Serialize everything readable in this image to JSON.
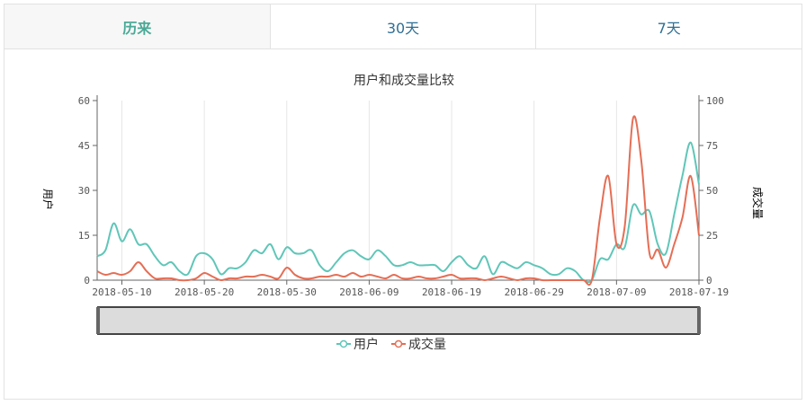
{
  "tabs": [
    {
      "label": "历来",
      "active": true
    },
    {
      "label": "30天",
      "active": false
    },
    {
      "label": "7天",
      "active": false
    }
  ],
  "colors": {
    "users": "#5fc6b8",
    "orders": "#e56e55",
    "active_tab_text": "#4aa996",
    "tab_text": "#2e6f93"
  },
  "chart_data": {
    "type": "line",
    "title": "用户和成交量比较",
    "y_left_label": "用户",
    "y_right_label": "成交量",
    "y_left_ticks": [
      "0",
      "15",
      "30",
      "45",
      "60"
    ],
    "y_right_ticks": [
      "0",
      "25",
      "50",
      "75",
      "100"
    ],
    "y_left_range": [
      0,
      60
    ],
    "y_right_range": [
      0,
      100
    ],
    "x_tick_labels": [
      "2018-05-10",
      "2018-05-20",
      "2018-05-30",
      "2018-06-09",
      "2018-06-19",
      "2018-06-29",
      "2018-07-09",
      "2018-07-19"
    ],
    "x_range": [
      "2018-05-07",
      "2018-07-19"
    ],
    "grid": "vertical",
    "legend": "bottom-center",
    "series": [
      {
        "name": "用户",
        "axis": "left",
        "x": [
          "2018-05-07",
          "2018-05-08",
          "2018-05-09",
          "2018-05-10",
          "2018-05-11",
          "2018-05-12",
          "2018-05-13",
          "2018-05-14",
          "2018-05-15",
          "2018-05-16",
          "2018-05-17",
          "2018-05-18",
          "2018-05-19",
          "2018-05-20",
          "2018-05-21",
          "2018-05-22",
          "2018-05-23",
          "2018-05-24",
          "2018-05-25",
          "2018-05-26",
          "2018-05-27",
          "2018-05-28",
          "2018-05-29",
          "2018-05-30",
          "2018-05-31",
          "2018-06-01",
          "2018-06-02",
          "2018-06-03",
          "2018-06-04",
          "2018-06-05",
          "2018-06-06",
          "2018-06-07",
          "2018-06-08",
          "2018-06-09",
          "2018-06-10",
          "2018-06-11",
          "2018-06-12",
          "2018-06-13",
          "2018-06-14",
          "2018-06-15",
          "2018-06-16",
          "2018-06-17",
          "2018-06-18",
          "2018-06-19",
          "2018-06-20",
          "2018-06-21",
          "2018-06-22",
          "2018-06-23",
          "2018-06-24",
          "2018-06-25",
          "2018-06-26",
          "2018-06-27",
          "2018-06-28",
          "2018-06-29",
          "2018-06-30",
          "2018-07-01",
          "2018-07-02",
          "2018-07-03",
          "2018-07-04",
          "2018-07-05",
          "2018-07-06",
          "2018-07-07",
          "2018-07-08",
          "2018-07-09",
          "2018-07-10",
          "2018-07-11",
          "2018-07-12",
          "2018-07-13",
          "2018-07-14",
          "2018-07-15",
          "2018-07-16",
          "2018-07-17",
          "2018-07-18",
          "2018-07-19"
        ],
        "values": [
          8,
          10,
          19,
          13,
          17,
          12,
          12,
          8,
          5,
          6,
          3,
          2,
          8,
          9,
          7,
          2,
          4,
          4,
          6,
          10,
          9,
          12,
          7,
          11,
          9,
          9,
          10,
          5,
          3,
          6,
          9,
          10,
          8,
          7,
          10,
          8,
          5,
          5,
          6,
          5,
          5,
          5,
          3,
          6,
          8,
          5,
          4,
          8,
          2,
          6,
          5,
          4,
          6,
          5,
          4,
          2,
          2,
          4,
          3,
          0,
          0,
          7,
          7,
          12,
          11,
          25,
          22,
          23,
          12,
          9,
          22,
          35,
          46,
          32
        ]
      },
      {
        "name": "成交量",
        "axis": "right",
        "x": [
          "2018-05-07",
          "2018-05-08",
          "2018-05-09",
          "2018-05-10",
          "2018-05-11",
          "2018-05-12",
          "2018-05-13",
          "2018-05-14",
          "2018-05-15",
          "2018-05-16",
          "2018-05-17",
          "2018-05-18",
          "2018-05-19",
          "2018-05-20",
          "2018-05-21",
          "2018-05-22",
          "2018-05-23",
          "2018-05-24",
          "2018-05-25",
          "2018-05-26",
          "2018-05-27",
          "2018-05-28",
          "2018-05-29",
          "2018-05-30",
          "2018-05-31",
          "2018-06-01",
          "2018-06-02",
          "2018-06-03",
          "2018-06-04",
          "2018-06-05",
          "2018-06-06",
          "2018-06-07",
          "2018-06-08",
          "2018-06-09",
          "2018-06-10",
          "2018-06-11",
          "2018-06-12",
          "2018-06-13",
          "2018-06-14",
          "2018-06-15",
          "2018-06-16",
          "2018-06-17",
          "2018-06-18",
          "2018-06-19",
          "2018-06-20",
          "2018-06-21",
          "2018-06-22",
          "2018-06-23",
          "2018-06-24",
          "2018-06-25",
          "2018-06-26",
          "2018-06-27",
          "2018-06-28",
          "2018-06-29",
          "2018-06-30",
          "2018-07-01",
          "2018-07-02",
          "2018-07-03",
          "2018-07-04",
          "2018-07-05",
          "2018-07-06",
          "2018-07-07",
          "2018-07-08",
          "2018-07-09",
          "2018-07-10",
          "2018-07-11",
          "2018-07-12",
          "2018-07-13",
          "2018-07-14",
          "2018-07-15",
          "2018-07-16",
          "2018-07-17",
          "2018-07-18",
          "2018-07-19"
        ],
        "values": [
          5,
          3,
          4,
          3,
          5,
          10,
          5,
          1,
          1,
          1,
          0,
          0,
          1,
          4,
          2,
          0,
          1,
          1,
          2,
          2,
          3,
          2,
          1,
          7,
          3,
          1,
          1,
          2,
          2,
          3,
          2,
          4,
          2,
          3,
          2,
          1,
          3,
          1,
          1,
          2,
          1,
          1,
          2,
          3,
          1,
          1,
          1,
          0,
          1,
          2,
          1,
          0,
          1,
          1,
          0,
          0,
          0,
          0,
          0,
          0,
          0,
          35,
          58,
          20,
          30,
          90,
          67,
          15,
          17,
          7,
          20,
          35,
          58,
          25
        ]
      }
    ]
  }
}
